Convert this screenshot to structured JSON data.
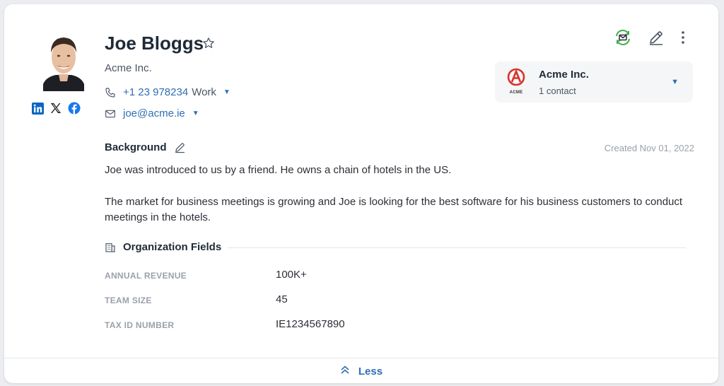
{
  "contact": {
    "name": "Joe Bloggs",
    "company": "Acme Inc.",
    "phone": "+1 23 978234",
    "phone_type": "Work",
    "email": "joe@acme.ie"
  },
  "social": [
    "linkedin-icon",
    "x-icon",
    "facebook-icon"
  ],
  "actions": [
    "email-sync-icon",
    "edit-icon",
    "more-icon"
  ],
  "company_card": {
    "name": "Acme Inc.",
    "contacts": "1 contact",
    "logo_text": "ACME"
  },
  "background": {
    "heading": "Background",
    "created": "Created Nov 01, 2022",
    "paragraphs": [
      "Joe was introduced to us by a friend. He owns a chain of hotels in the US.",
      "The market for business meetings is growing and Joe is looking for the best software for his business customers to conduct meetings in the hotels."
    ]
  },
  "org_fields": {
    "heading": "Organization Fields",
    "fields": [
      {
        "label": "ANNUAL REVENUE",
        "value": "100K+"
      },
      {
        "label": "TEAM SIZE",
        "value": "45"
      },
      {
        "label": "TAX ID NUMBER",
        "value": "IE1234567890"
      }
    ]
  },
  "footer": {
    "label": "Less"
  },
  "colors": {
    "accent": "#2f6fb3",
    "sync_green": "#3fae49",
    "logo_red": "#d9322b"
  }
}
